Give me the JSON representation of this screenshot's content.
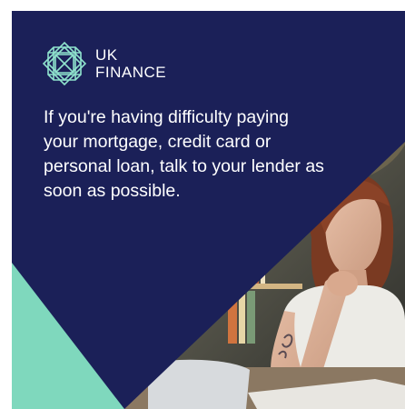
{
  "brand": {
    "line1": "UK",
    "line2": "FINANCE",
    "navy": "#1b2058",
    "mint": "#7fd8bd"
  },
  "message": {
    "text": "If you're having difficulty paying your mortgage, credit card or personal loan, talk to your lender as soon as possible."
  },
  "icons": {
    "logo": "uk-finance-lattice-icon"
  }
}
